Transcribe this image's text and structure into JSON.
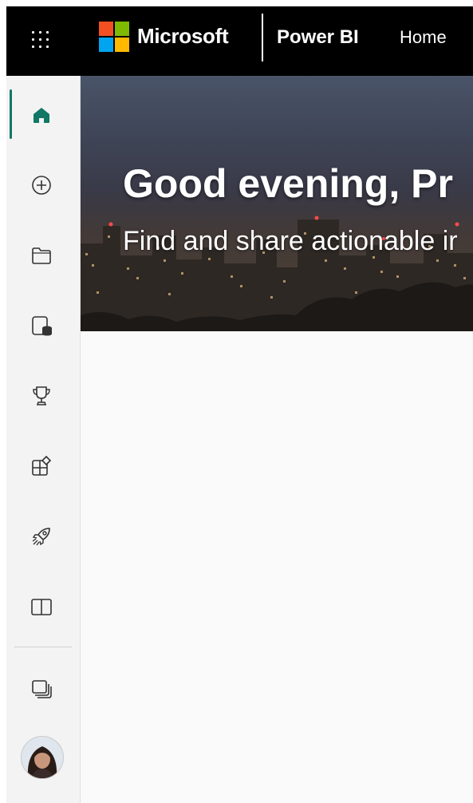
{
  "topbar": {
    "brand": "Microsoft",
    "app_name": "Power BI",
    "breadcrumb": "Home"
  },
  "leftnav": {
    "items": [
      {
        "name": "home",
        "icon": "home-icon",
        "active": true
      },
      {
        "name": "create",
        "icon": "plus-circle-icon"
      },
      {
        "name": "browse",
        "icon": "folder-icon"
      },
      {
        "name": "onelake",
        "icon": "database-icon"
      },
      {
        "name": "metrics",
        "icon": "trophy-icon"
      },
      {
        "name": "apps",
        "icon": "apps-icon"
      },
      {
        "name": "learn",
        "icon": "rocket-icon"
      },
      {
        "name": "workspaces",
        "icon": "book-icon"
      },
      {
        "name": "my-workspace",
        "icon": "stacked-pages-icon"
      }
    ],
    "accent_color": "#117865"
  },
  "hero": {
    "greeting": "Good evening, Pr",
    "subtitle": "Find and share actionable ir"
  },
  "colors": {
    "topbar_bg": "#000000",
    "nav_bg": "#f3f3f3",
    "main_bg": "#fafafa",
    "ms_red": "#f25022",
    "ms_green": "#7fba00",
    "ms_blue": "#00a4ef",
    "ms_yellow": "#ffb900"
  }
}
